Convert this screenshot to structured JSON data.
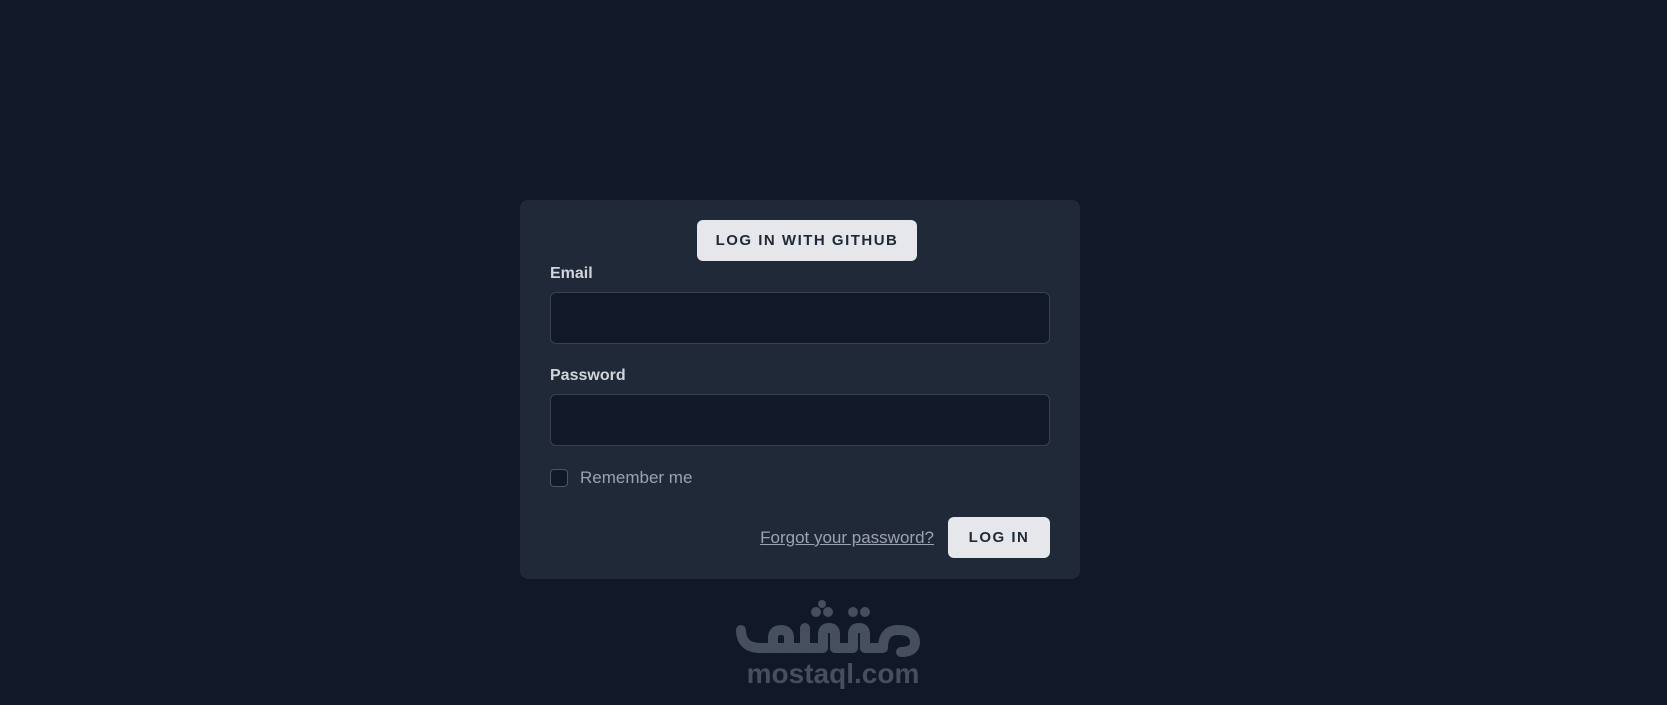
{
  "login": {
    "github_button_label": "LOG IN WITH GITHUB",
    "email_label": "Email",
    "email_value": "",
    "password_label": "Password",
    "password_value": "",
    "remember_label": "Remember me",
    "remember_checked": false,
    "forgot_link": "Forgot your password?",
    "login_button_label": "LOG IN"
  },
  "watermark": {
    "logo_text": "مستقل",
    "url": "mostaql.com"
  },
  "colors": {
    "background": "#111827",
    "card": "#1f2937",
    "button": "#e5e7eb",
    "input_bg": "#111827",
    "text_light": "#d1d5db",
    "text_muted": "#9ca3af"
  }
}
